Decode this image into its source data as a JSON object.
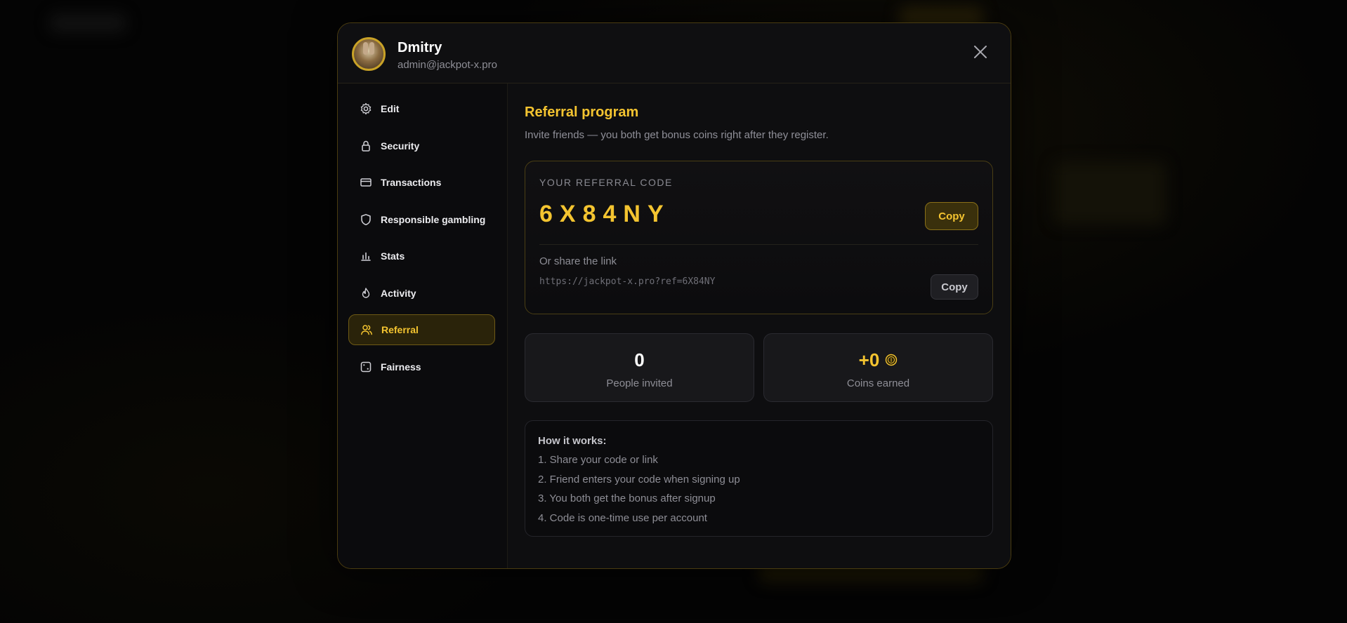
{
  "profile": {
    "name": "Dmitry",
    "email": "admin@jackpot-x.pro"
  },
  "sidebar": {
    "items": [
      {
        "label": "Edit",
        "icon": "gear-icon"
      },
      {
        "label": "Security",
        "icon": "lock-icon"
      },
      {
        "label": "Transactions",
        "icon": "card-icon"
      },
      {
        "label": "Responsible gambling",
        "icon": "shield-icon"
      },
      {
        "label": "Stats",
        "icon": "bar-chart-icon"
      },
      {
        "label": "Activity",
        "icon": "flame-icon"
      },
      {
        "label": "Referral",
        "icon": "users-icon",
        "active": true
      },
      {
        "label": "Fairness",
        "icon": "dice-icon"
      }
    ]
  },
  "referral": {
    "title": "Referral program",
    "subtitle": "Invite friends — you both get bonus coins right after they register.",
    "code_label": "YOUR REFERRAL CODE",
    "code": "6X84NY",
    "copy_label": "Copy",
    "share_label": "Or share the link",
    "share_link": "https://jackpot-x.pro?ref=6X84NY",
    "copy_link_label": "Copy"
  },
  "stats": {
    "invited_value": "0",
    "invited_label": "People invited",
    "coins_value": "+0",
    "coins_label": "Coins earned",
    "coin_icon": "coin-icon"
  },
  "how_it_works": {
    "title": "How it works:",
    "steps": [
      "1. Share your code or link",
      "2. Friend enters your code when signing up",
      "3. You both get the bonus after signup",
      "4. Code is one-time use per account"
    ]
  },
  "colors": {
    "accent": "#f4c430",
    "background": "#0d0d0f",
    "muted_text": "#8e8e96"
  }
}
